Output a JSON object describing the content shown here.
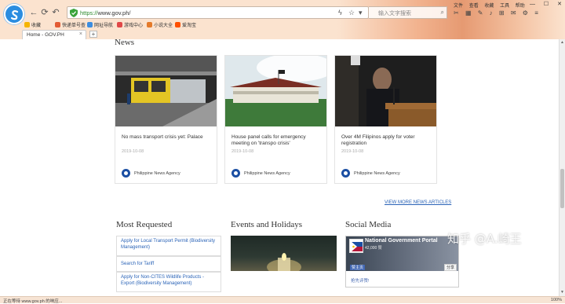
{
  "browser": {
    "menu": [
      "文件",
      "查看",
      "收藏",
      "工具",
      "帮助"
    ],
    "url_protocol": "https://",
    "url_rest": "www.gov.ph/",
    "search_placeholder": "输入文字搜索",
    "bookmarks": [
      "收藏",
      "快递单号查",
      "网址导航",
      "游戏中心",
      "小说大全",
      "爱淘宝"
    ],
    "tab_title": "Home - GOV.PH",
    "new_tab": "+"
  },
  "news": {
    "heading": "News",
    "cards": [
      {
        "title": "No mass transport crisis yet: Palace",
        "date": "2019-10-08",
        "agency": "Philippine News Agency"
      },
      {
        "title": "House panel calls for emergency meeting on 'transpo crisis'",
        "date": "2019-10-08",
        "agency": "Philippine News Agency"
      },
      {
        "title": "Over 4M Filipinos apply for voter registration",
        "date": "2019-10-08",
        "agency": "Philippine News Agency"
      }
    ],
    "view_more": "VIEW MORE NEWS ARTICLES"
  },
  "most_requested": {
    "heading": "Most Requested",
    "items": [
      "Apply for Local Transport Permit (Biodiversity Management)",
      "Search for Tariff",
      "Apply for Non-CITES Wildlife Products - Export (Biodiversity Management)"
    ]
  },
  "events": {
    "heading": "Events and Holidays"
  },
  "social": {
    "heading": "Social Media",
    "page_name": "National Government Portal",
    "likes": "42,000 赞",
    "like_button": "赞主页",
    "share_button": "分享",
    "footer": "抢先评赞!"
  },
  "watermark": "知乎 @A.崎王",
  "status": {
    "left": "正在等待 www.gov.ph 的响应...",
    "zoom": "100%"
  }
}
